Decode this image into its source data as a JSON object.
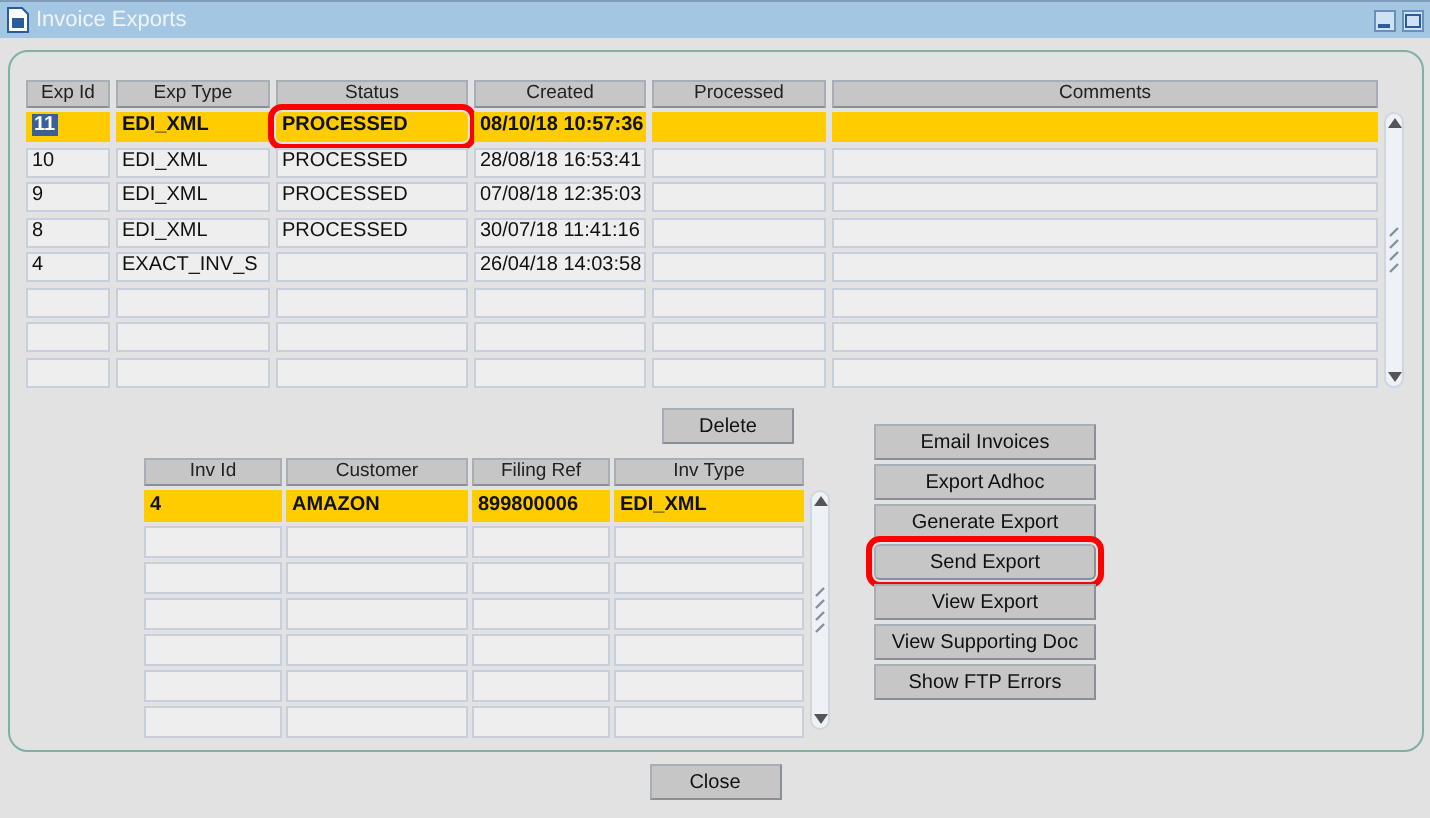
{
  "window": {
    "title": "Invoice Exports"
  },
  "exports": {
    "columns": [
      "Exp Id",
      "Exp Type",
      "Status",
      "Created",
      "Processed",
      "Comments"
    ],
    "rows": [
      {
        "selected": true,
        "cells": [
          "11",
          "EDI_XML",
          "PROCESSED",
          "08/10/18 10:57:36"
        ],
        "status_highlighted": true
      },
      {
        "selected": false,
        "cells": [
          "10",
          "EDI_XML",
          "PROCESSED",
          "28/08/18 16:53:41"
        ]
      },
      {
        "selected": false,
        "cells": [
          "9",
          "EDI_XML",
          "PROCESSED",
          "07/08/18 12:35:03"
        ]
      },
      {
        "selected": false,
        "cells": [
          "8",
          "EDI_XML",
          "PROCESSED",
          "30/07/18 11:41:16"
        ]
      },
      {
        "selected": false,
        "cells": [
          "4",
          "EXACT_INV_S",
          "",
          "26/04/18 14:03:58"
        ]
      }
    ]
  },
  "delete_button": "Delete",
  "invoices": {
    "columns": [
      "Inv Id",
      "Customer",
      "Filing Ref",
      "Inv Type"
    ],
    "rows": [
      {
        "selected": true,
        "cells": [
          "4",
          "AMAZON",
          "899800006",
          "EDI_XML"
        ]
      }
    ]
  },
  "actions": [
    {
      "label": "Email Invoices",
      "highlighted": false
    },
    {
      "label": "Export Adhoc",
      "highlighted": false
    },
    {
      "label": "Generate Export",
      "highlighted": false
    },
    {
      "label": "Send Export",
      "highlighted": true
    },
    {
      "label": "View Export",
      "highlighted": false
    },
    {
      "label": "View Supporting Doc",
      "highlighted": false
    },
    {
      "label": "Show FTP Errors",
      "highlighted": false
    }
  ],
  "close_button": "Close"
}
